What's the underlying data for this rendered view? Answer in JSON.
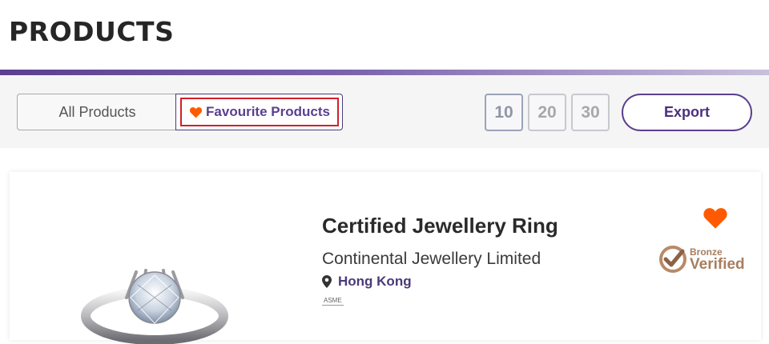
{
  "page": {
    "title": "PRODUCTS"
  },
  "toolbar": {
    "tabs": [
      {
        "label": "All Products",
        "selected": false
      },
      {
        "label": "Favourite Products",
        "selected": true
      }
    ],
    "page_sizes": [
      "10",
      "20",
      "30"
    ],
    "active_page_size": "10",
    "export_label": "Export"
  },
  "product": {
    "name": "Certified Jewellery Ring",
    "company": "Continental Jewellery Limited",
    "location": "Hong Kong",
    "cert_logo_text": "ASME",
    "favourited": true,
    "verification": {
      "tier": "Bronze",
      "label": "Verified"
    }
  },
  "colors": {
    "accent": "#5b3f90",
    "heart": "#ff5a00",
    "selected_outline": "#d0202a",
    "bronze": "#a77e5f"
  },
  "icons": [
    "heart-icon",
    "map-pin-icon",
    "bronze-verified-icon"
  ]
}
